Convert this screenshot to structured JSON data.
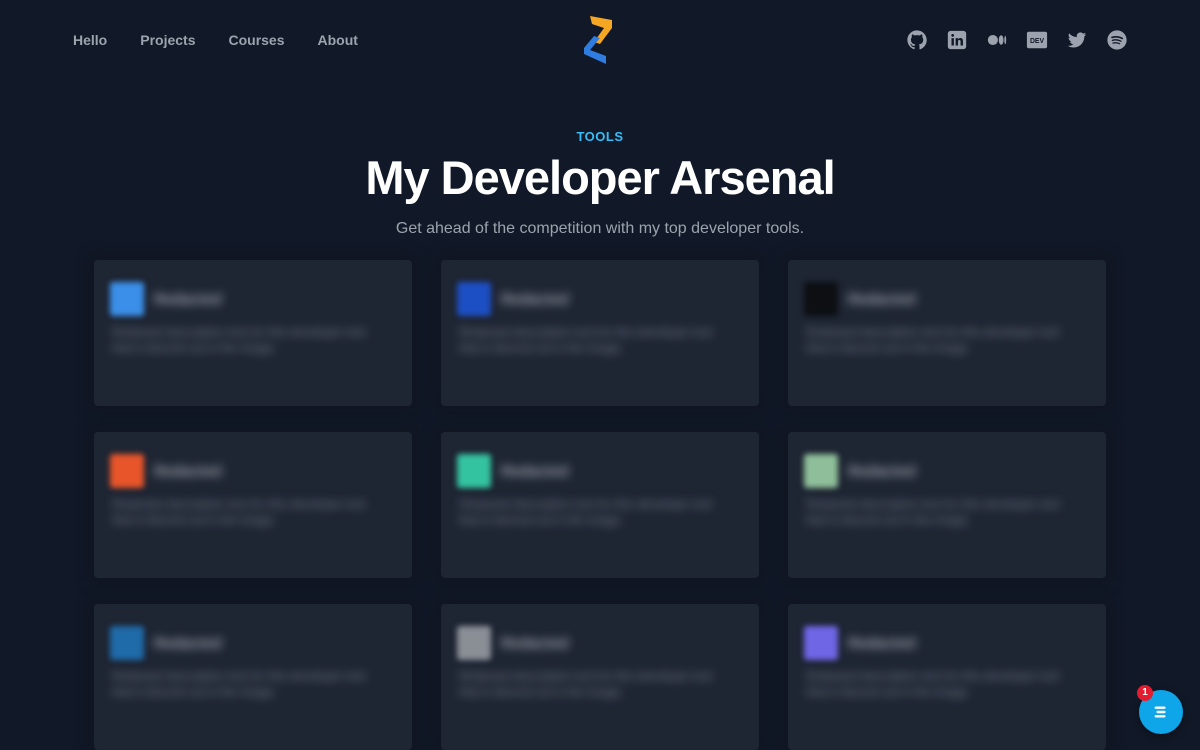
{
  "nav": {
    "links": [
      "Hello",
      "Projects",
      "Courses",
      "About"
    ]
  },
  "logo": {
    "name": "zen-logo",
    "colors": [
      "#f59e0b",
      "#3b82f6"
    ]
  },
  "socials": [
    {
      "name": "github-icon",
      "label": "GitHub"
    },
    {
      "name": "linkedin-icon",
      "label": "LinkedIn"
    },
    {
      "name": "medium-icon",
      "label": "Medium"
    },
    {
      "name": "dev-icon",
      "label": "DEV"
    },
    {
      "name": "twitter-icon",
      "label": "Twitter"
    },
    {
      "name": "spotify-icon",
      "label": "Spotify"
    }
  ],
  "hero": {
    "eyebrow": "TOOLS",
    "title": "My Developer Arsenal",
    "subtitle": "Get ahead of the competition with my top developer tools."
  },
  "cards": [
    {
      "icon_color": "#3b8fe8",
      "name": "Redacted",
      "desc": "Redacted description text for this developer tool that is blurred out in the image."
    },
    {
      "icon_color": "#1d4fc4",
      "name": "Redacted",
      "desc": "Redacted description text for this developer tool that is blurred out in the image."
    },
    {
      "icon_color": "#0d0f12",
      "name": "Redacted",
      "desc": "Redacted description text for this developer tool that is blurred out in the image."
    },
    {
      "icon_color": "#e8552a",
      "name": "Redacted",
      "desc": "Redacted description text for this developer tool that is blurred out in the image."
    },
    {
      "icon_color": "#34c3a0",
      "name": "Redacted",
      "desc": "Redacted description text for this developer tool that is blurred out in the image."
    },
    {
      "icon_color": "#8fbf9a",
      "name": "Redacted",
      "desc": "Redacted description text for this developer tool that is blurred out in the image."
    },
    {
      "icon_color": "#1f6aa8",
      "name": "Redacted",
      "desc": "Redacted description text for this developer tool that is blurred out in the image."
    },
    {
      "icon_color": "#8a8f96",
      "name": "Redacted",
      "desc": "Redacted description text for this developer tool that is blurred out in the image."
    },
    {
      "icon_color": "#6f66e6",
      "name": "Redacted",
      "desc": "Redacted description text for this developer tool that is blurred out in the image."
    }
  ],
  "chat": {
    "badge": "1",
    "icon": "chat-icon",
    "color": "#0ea5e9"
  }
}
